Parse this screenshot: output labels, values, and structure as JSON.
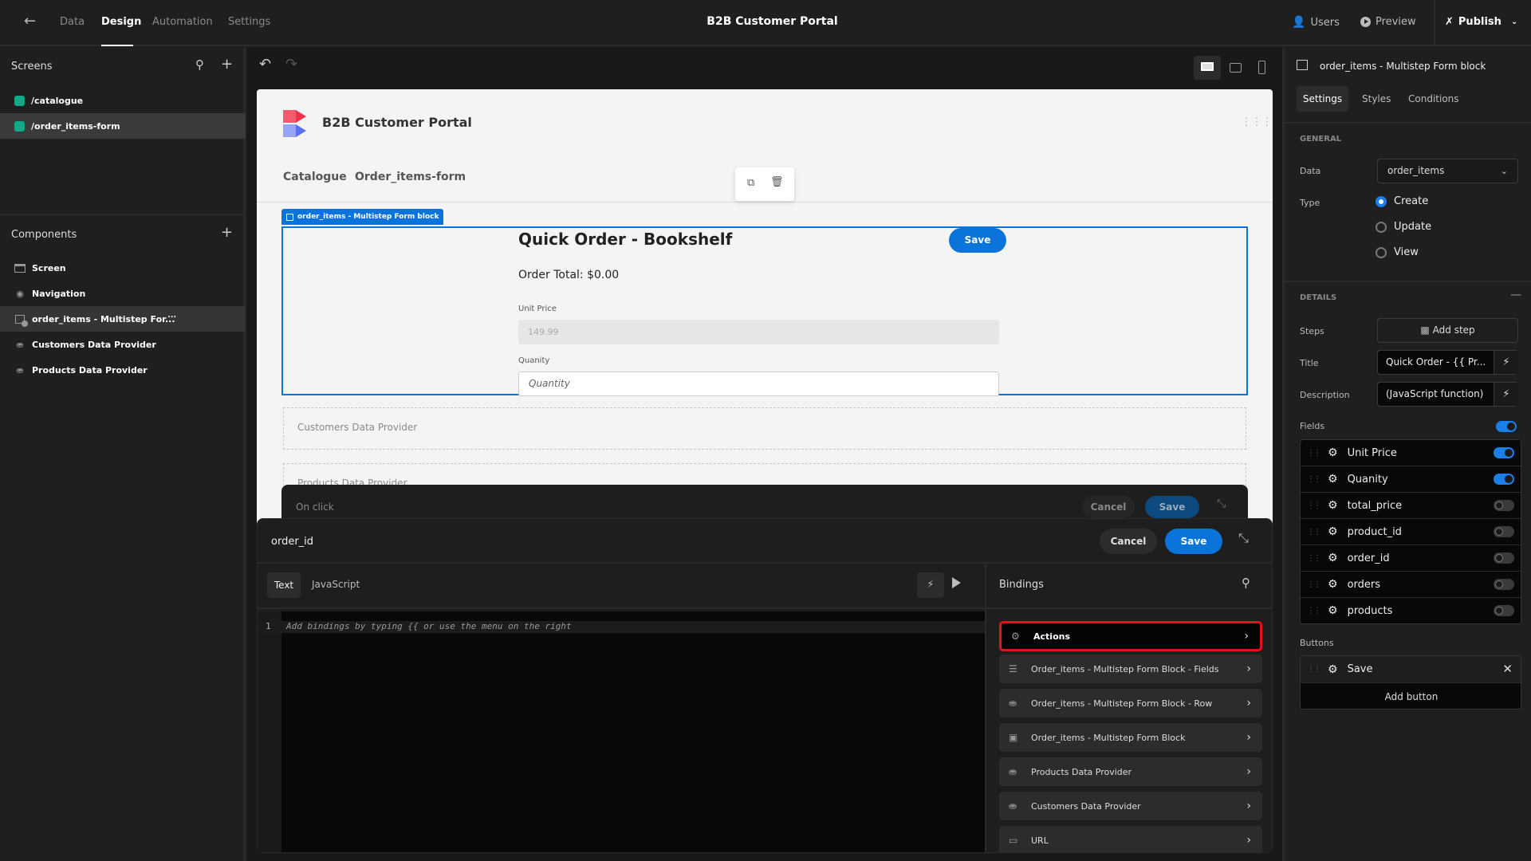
{
  "topbar": {
    "back_icon": "arrow-left-icon",
    "tabs": [
      {
        "label": "Data",
        "active": false
      },
      {
        "label": "Design",
        "active": true
      },
      {
        "label": "Automation",
        "active": false
      },
      {
        "label": "Settings",
        "active": false
      }
    ],
    "title": "B2B Customer Portal",
    "users_label": "Users",
    "preview_label": "Preview",
    "publish_label": "Publish"
  },
  "sidebar": {
    "screens_title": "Screens",
    "screens": [
      {
        "label": "/catalogue",
        "selected": false
      },
      {
        "label": "/order_items-form",
        "selected": true
      }
    ],
    "components_title": "Components",
    "components": [
      {
        "label": "Screen",
        "icon": "screen-icon"
      },
      {
        "label": "Navigation",
        "icon": "eye-icon"
      },
      {
        "label": "order_items - Multistep For...",
        "icon": "form-block-icon",
        "selected": true
      },
      {
        "label": "Customers Data Provider",
        "icon": "database-icon"
      },
      {
        "label": "Products Data Provider",
        "icon": "database-icon"
      }
    ]
  },
  "preview": {
    "app_name": "B2B Customer Portal",
    "nav_links": [
      "Catalogue",
      "Order_items-form"
    ],
    "block_tag": "order_items - Multistep Form block",
    "form_title": "Quick Order - Bookshelf",
    "save_label": "Save",
    "order_total": "Order Total: $0.00",
    "unit_price_label": "Unit Price",
    "unit_price_value": "149.99",
    "quantity_label": "Quanity",
    "quantity_placeholder": "Quantity",
    "customers_provider": "Customers Data Provider",
    "products_provider": "Products Data Provider"
  },
  "onclick_panel": {
    "title": "On click",
    "cancel_label": "Cancel",
    "save_label": "Save"
  },
  "binding_panel": {
    "title": "order_id",
    "cancel_label": "Cancel",
    "save_label": "Save",
    "tabs": [
      {
        "label": "Text",
        "active": true
      },
      {
        "label": "JavaScript",
        "active": false
      }
    ],
    "line_number": "1",
    "editor_placeholder": "Add bindings by typing {{ or use the menu on the right",
    "bindings_title": "Bindings",
    "bindings": [
      {
        "label": "Actions",
        "icon": "actions-icon",
        "highlighted": true
      },
      {
        "label": "Order_items - Multistep Form Block - Fields",
        "icon": "fields-icon"
      },
      {
        "label": "Order_items - Multistep Form Block - Row",
        "icon": "database-icon"
      },
      {
        "label": "Order_items - Multistep Form Block",
        "icon": "form-block-icon"
      },
      {
        "label": "Products Data Provider",
        "icon": "database-icon"
      },
      {
        "label": "Customers Data Provider",
        "icon": "database-icon"
      },
      {
        "label": "URL",
        "icon": "browser-icon"
      }
    ]
  },
  "rpanel": {
    "component_title": "order_items - Multistep Form block",
    "tabs": [
      {
        "label": "Settings",
        "active": true
      },
      {
        "label": "Styles",
        "active": false
      },
      {
        "label": "Conditions",
        "active": false
      }
    ],
    "general_title": "GENERAL",
    "data_label": "Data",
    "data_value": "order_items",
    "type_label": "Type",
    "type_options": [
      {
        "label": "Create",
        "selected": true
      },
      {
        "label": "Update",
        "selected": false
      },
      {
        "label": "View",
        "selected": false
      }
    ],
    "details_title": "DETAILS",
    "steps_label": "Steps",
    "add_step_label": "Add step",
    "title_label": "Title",
    "title_value": "Quick Order - {{ Pr...",
    "description_label": "Description",
    "description_value": "(JavaScript function)",
    "fields_label": "Fields",
    "fields_enabled": true,
    "fields": [
      {
        "label": "Unit Price",
        "enabled": true
      },
      {
        "label": "Quanity",
        "enabled": true
      },
      {
        "label": "total_price",
        "enabled": false
      },
      {
        "label": "product_id",
        "enabled": false
      },
      {
        "label": "order_id",
        "enabled": false
      },
      {
        "label": "orders",
        "enabled": false
      },
      {
        "label": "products",
        "enabled": false
      }
    ],
    "buttons_label": "Buttons",
    "buttons": [
      {
        "label": "Save"
      }
    ],
    "add_button_label": "Add button"
  },
  "colors": {
    "accent": "#0a74da",
    "highlight_border": "#e8101f",
    "screen_icon": "#14a884"
  }
}
